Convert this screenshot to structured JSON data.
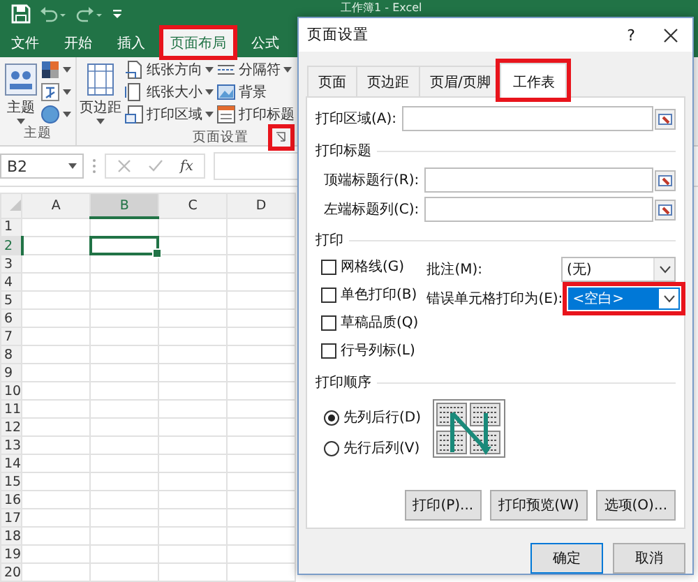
{
  "app": {
    "title": "工作簿1 - Excel"
  },
  "ribbon_tabs": [
    {
      "label": "文件",
      "selected": false,
      "highlighted": false
    },
    {
      "label": "开始",
      "selected": false,
      "highlighted": false
    },
    {
      "label": "插入",
      "selected": false,
      "highlighted": false
    },
    {
      "label": "页面布局",
      "selected": true,
      "highlighted": true
    },
    {
      "label": "公式",
      "selected": false,
      "highlighted": false
    }
  ],
  "theme_group": {
    "label": "主题",
    "button": "主题"
  },
  "page_setup_group": {
    "label": "页面设置",
    "launcher_highlighted": true,
    "big_button": "页边距",
    "small_buttons": [
      {
        "label": "纸张方向",
        "dropdown": true
      },
      {
        "label": "纸张大小",
        "dropdown": true
      },
      {
        "label": "打印区域",
        "dropdown": true
      },
      {
        "label": "分隔符",
        "dropdown": true
      },
      {
        "label": "背景",
        "dropdown": false
      },
      {
        "label": "打印标题",
        "dropdown": false
      }
    ]
  },
  "formula_bar": {
    "name_box": "B2",
    "fx": "fx"
  },
  "sheet": {
    "columns": [
      {
        "label": "A",
        "selected": false
      },
      {
        "label": "B",
        "selected": true
      },
      {
        "label": "C",
        "selected": false
      },
      {
        "label": "D",
        "selected": false
      }
    ],
    "rows": [
      {
        "label": "1",
        "selected": false
      },
      {
        "label": "2",
        "selected": true
      },
      {
        "label": "3",
        "selected": false
      },
      {
        "label": "4",
        "selected": false
      },
      {
        "label": "5",
        "selected": false
      },
      {
        "label": "6",
        "selected": false
      },
      {
        "label": "7",
        "selected": false
      },
      {
        "label": "8",
        "selected": false
      },
      {
        "label": "9",
        "selected": false
      },
      {
        "label": "10",
        "selected": false
      },
      {
        "label": "11",
        "selected": false
      },
      {
        "label": "12",
        "selected": false
      },
      {
        "label": "13",
        "selected": false
      },
      {
        "label": "14",
        "selected": false
      },
      {
        "label": "15",
        "selected": false
      },
      {
        "label": "16",
        "selected": false
      },
      {
        "label": "17",
        "selected": false
      },
      {
        "label": "18",
        "selected": false
      },
      {
        "label": "19",
        "selected": false
      },
      {
        "label": "20",
        "selected": false
      }
    ]
  },
  "dialog": {
    "title": "页面设置",
    "help": "?",
    "tabs": [
      {
        "label": "页面",
        "selected": false,
        "highlighted": false
      },
      {
        "label": "页边距",
        "selected": false,
        "highlighted": false
      },
      {
        "label": "页眉/页脚",
        "selected": false,
        "highlighted": false
      },
      {
        "label": "工作表",
        "selected": true,
        "highlighted": true
      }
    ],
    "print_area": {
      "label": "打印区域(A):"
    },
    "print_titles": {
      "heading": "打印标题",
      "fields": [
        {
          "label": "顶端标题行(R):"
        },
        {
          "label": "左端标题列(C):"
        }
      ]
    },
    "print": {
      "heading": "打印",
      "checkboxes": [
        {
          "label": "网格线(G)",
          "checked": false
        },
        {
          "label": "单色打印(B)",
          "checked": false
        },
        {
          "label": "草稿品质(Q)",
          "checked": false
        },
        {
          "label": "行号列标(L)",
          "checked": false
        }
      ],
      "dropdowns": [
        {
          "label": "批注(M):",
          "value": "(无)",
          "focused": false,
          "highlighted": false
        },
        {
          "label": "错误单元格打印为(E):",
          "value": "<空白>",
          "focused": true,
          "highlighted": true
        }
      ]
    },
    "page_order": {
      "heading": "打印顺序",
      "options": [
        {
          "label": "先列后行(D)",
          "selected": true
        },
        {
          "label": "先行后列(V)",
          "selected": false
        }
      ]
    },
    "action_buttons": [
      "打印(P)...",
      "打印预览(W)",
      "选项(O)..."
    ],
    "footer_buttons": [
      {
        "label": "确定",
        "default": true
      },
      {
        "label": "取消",
        "default": false
      }
    ]
  }
}
